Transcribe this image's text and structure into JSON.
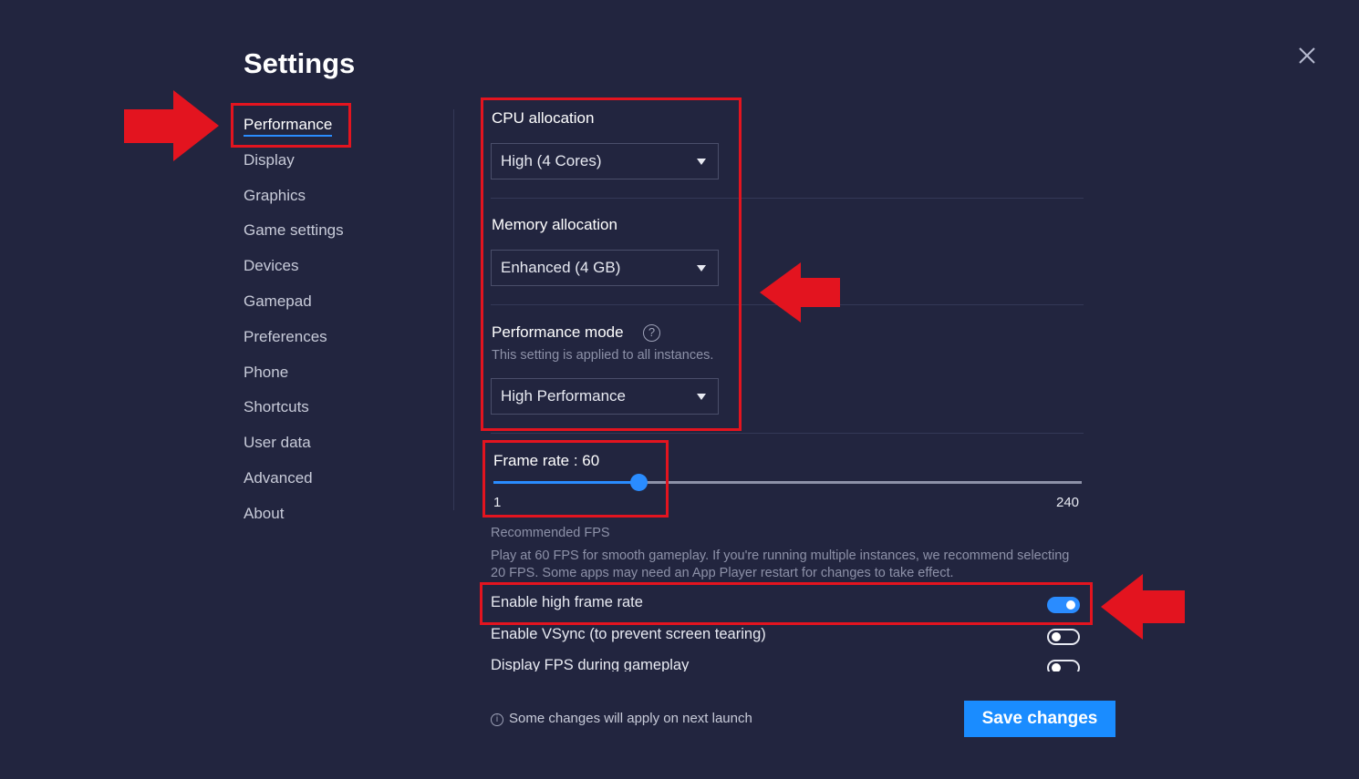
{
  "window": {
    "title": "Settings"
  },
  "sidebar": {
    "items": [
      {
        "label": "Performance",
        "active": true
      },
      {
        "label": "Display"
      },
      {
        "label": "Graphics"
      },
      {
        "label": "Game settings"
      },
      {
        "label": "Devices"
      },
      {
        "label": "Gamepad"
      },
      {
        "label": "Preferences"
      },
      {
        "label": "Phone"
      },
      {
        "label": "Shortcuts"
      },
      {
        "label": "User data"
      },
      {
        "label": "Advanced"
      },
      {
        "label": "About"
      }
    ]
  },
  "performance": {
    "cpu": {
      "label": "CPU allocation",
      "value": "High (4 Cores)"
    },
    "memory": {
      "label": "Memory allocation",
      "value": "Enhanced (4 GB)"
    },
    "mode": {
      "label": "Performance mode",
      "note": "This setting is applied to all instances.",
      "value": "High Performance",
      "help_icon": "?"
    },
    "frame_rate": {
      "label": "Frame rate : 60",
      "value": 60,
      "min": 1,
      "max": 240,
      "min_label": "1",
      "max_label": "240"
    },
    "recommended": {
      "title": "Recommended FPS",
      "text": "Play at 60 FPS for smooth gameplay. If you're running multiple instances, we recommend selecting 20 FPS. Some apps may need an App Player restart for changes to take effect."
    },
    "toggles": [
      {
        "label": "Enable high frame rate",
        "on": true
      },
      {
        "label": "Enable VSync (to prevent screen tearing)",
        "on": false
      },
      {
        "label": "Display FPS during gameplay",
        "on": false
      }
    ]
  },
  "footer": {
    "note": "Some changes will apply on next launch",
    "info_icon": "i",
    "save_label": "Save changes"
  },
  "colors": {
    "background": "#22253f",
    "accent": "#2a8cff",
    "highlight": "#e3141f"
  }
}
